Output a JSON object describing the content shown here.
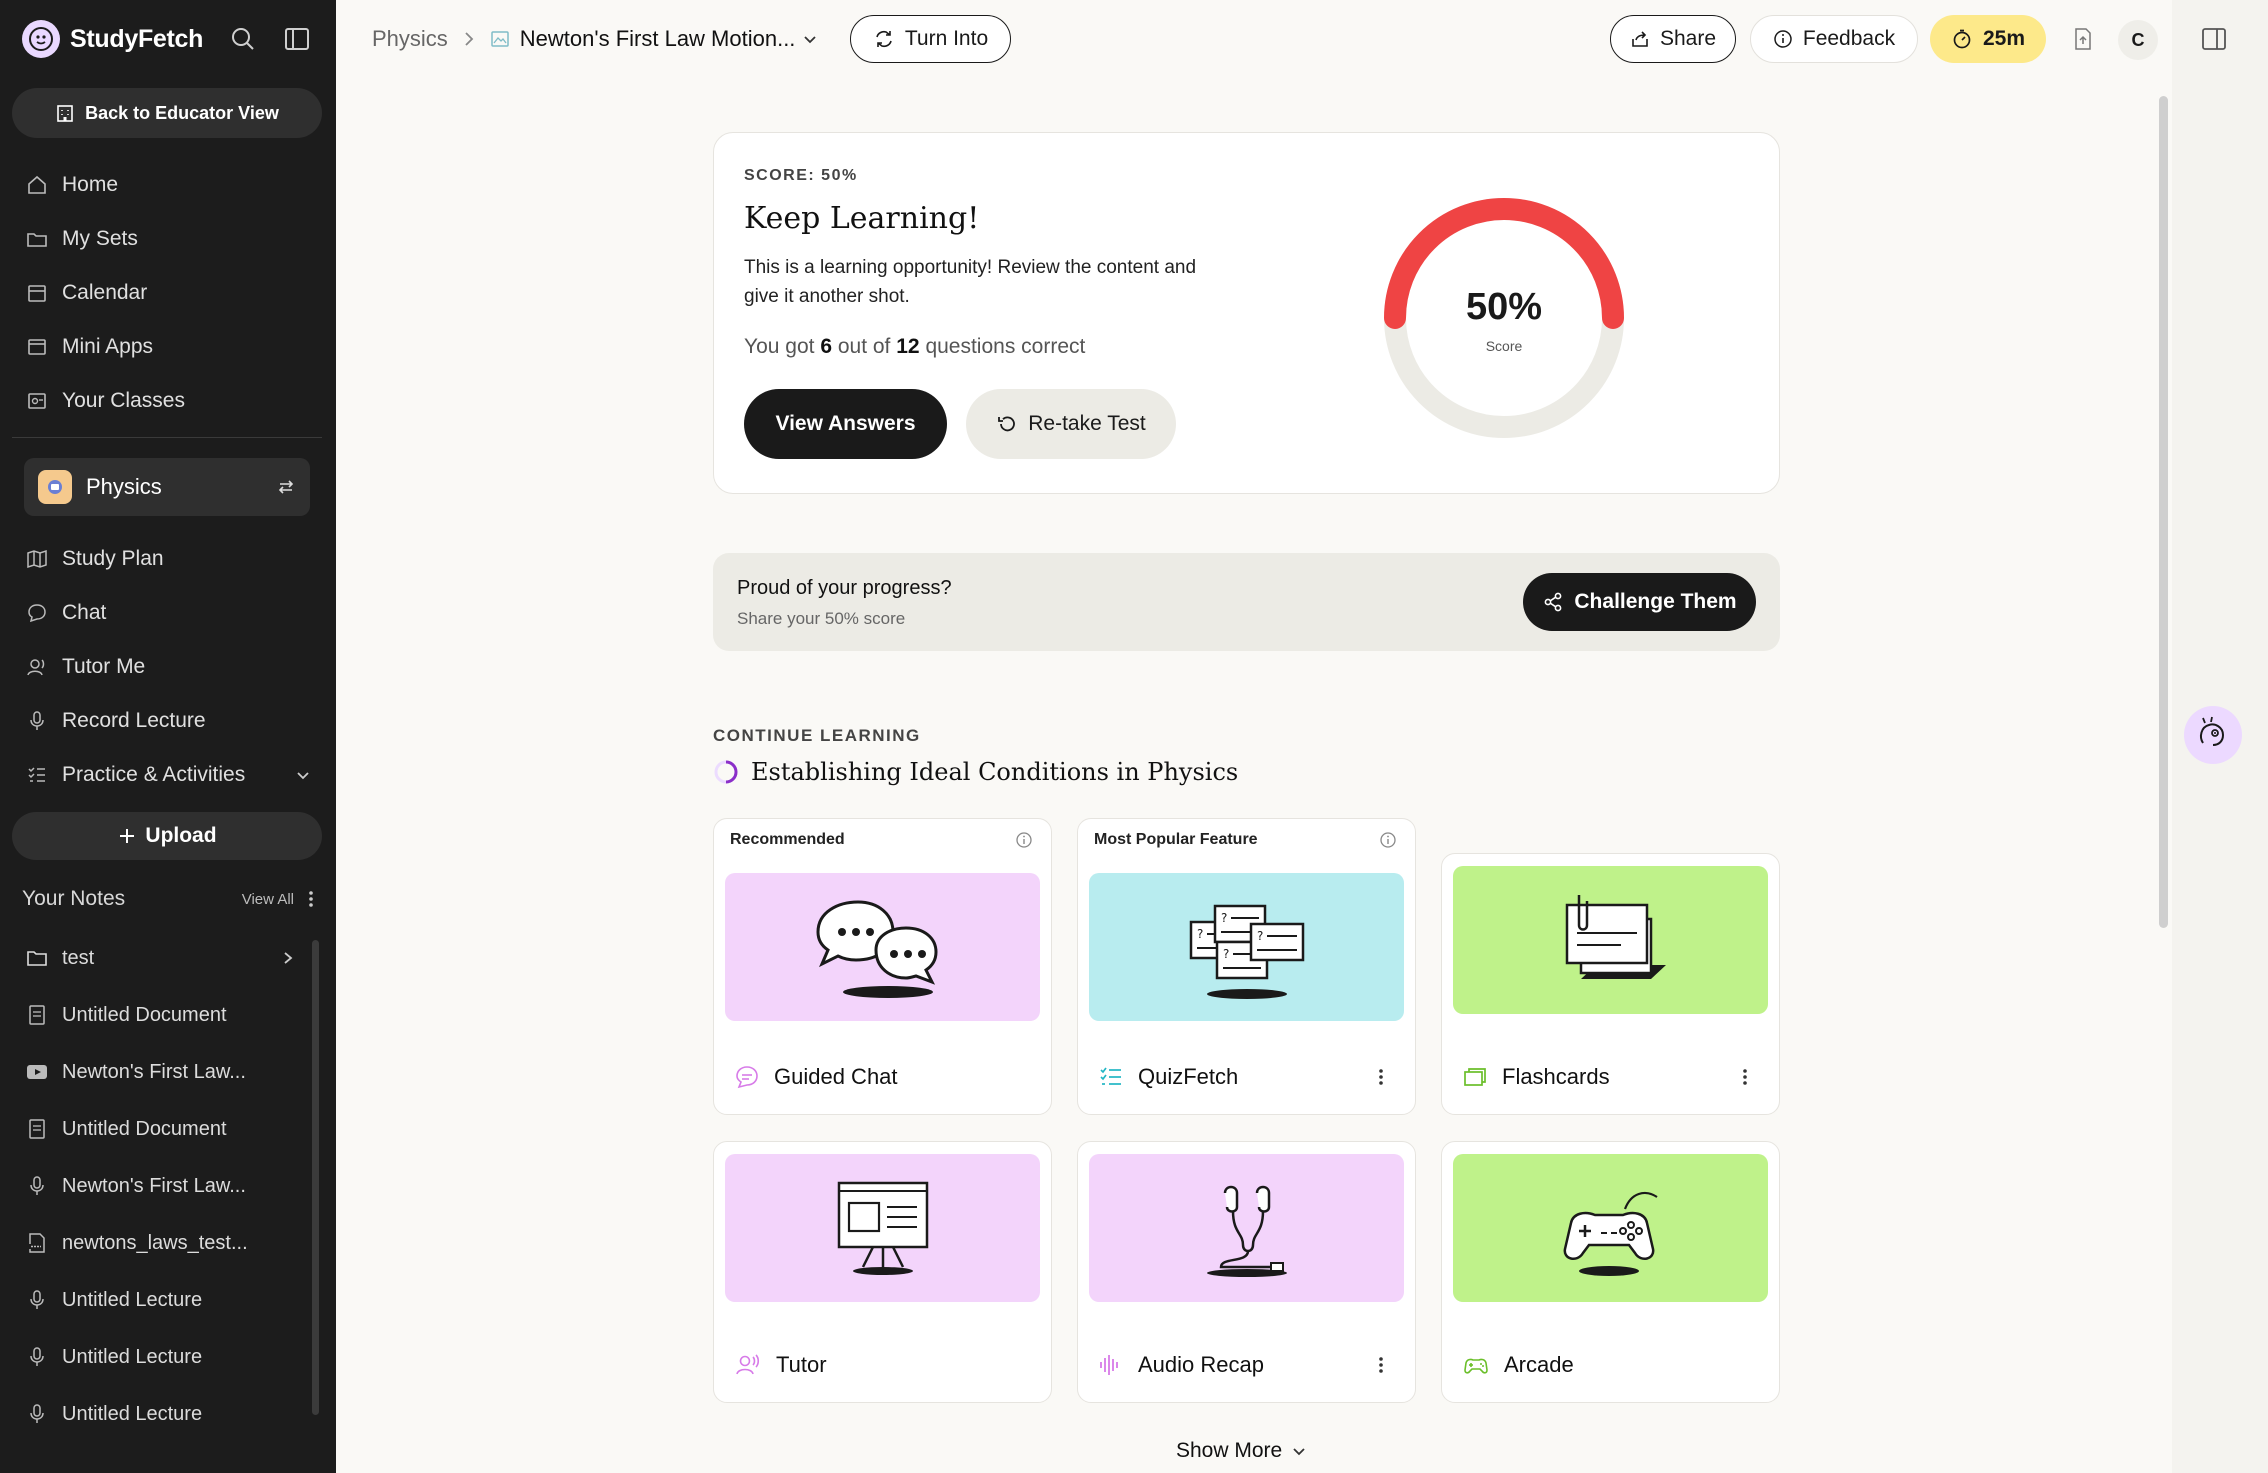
{
  "app": {
    "name": "StudyFetch"
  },
  "sidebar": {
    "educator_button": "Back to Educator View",
    "nav": [
      {
        "label": "Home",
        "icon": "home-icon"
      },
      {
        "label": "My Sets",
        "icon": "folder-icon"
      },
      {
        "label": "Calendar",
        "icon": "calendar-icon"
      },
      {
        "label": "Mini Apps",
        "icon": "window-icon"
      },
      {
        "label": "Your Classes",
        "icon": "classes-icon"
      }
    ],
    "subject": {
      "name": "Physics"
    },
    "subject_nav": [
      {
        "label": "Study Plan",
        "icon": "map-icon"
      },
      {
        "label": "Chat",
        "icon": "chat-icon"
      },
      {
        "label": "Tutor Me",
        "icon": "tutor-icon"
      },
      {
        "label": "Record Lecture",
        "icon": "mic-icon"
      },
      {
        "label": "Practice & Activities",
        "icon": "list-icon"
      }
    ],
    "upload_label": "Upload",
    "notes_title": "Your Notes",
    "notes_view_all": "View All",
    "notes": [
      {
        "label": "test",
        "icon": "folder-icon"
      },
      {
        "label": "Untitled Document",
        "icon": "document-icon"
      },
      {
        "label": "Newton's First Law...",
        "icon": "youtube-icon"
      },
      {
        "label": "Untitled Document",
        "icon": "document-icon"
      },
      {
        "label": "Newton's First Law...",
        "icon": "mic-icon"
      },
      {
        "label": "newtons_laws_test...",
        "icon": "pdf-icon"
      },
      {
        "label": "Untitled Lecture",
        "icon": "mic-icon"
      },
      {
        "label": "Untitled Lecture",
        "icon": "mic-icon"
      },
      {
        "label": "Untitled Lecture",
        "icon": "mic-icon"
      }
    ]
  },
  "header": {
    "breadcrumb_root": "Physics",
    "breadcrumb_current": "Newton's First Law Motion...",
    "turn_into": "Turn Into",
    "share": "Share",
    "feedback": "Feedback",
    "timer": "25m",
    "avatar_initial": "C"
  },
  "score": {
    "label": "SCORE: 50%",
    "heading": "Keep Learning!",
    "description": "This is a learning opportunity! Review the content and give it another shot.",
    "stat_prefix": "You got",
    "correct": "6",
    "stat_mid": "out of",
    "total": "12",
    "stat_suffix": "questions correct",
    "gauge_value": "50%",
    "gauge_label": "Score",
    "gauge_fraction": 0.5,
    "gauge_color": "#ef4444",
    "view_answers": "View Answers",
    "retake": "Re-take Test"
  },
  "progress_share": {
    "title": "Proud of your progress?",
    "subtitle": "Share your 50% score",
    "button": "Challenge Them"
  },
  "continue_learning": {
    "label": "CONTINUE LEARNING",
    "title": "Establishing Ideal Conditions in Physics"
  },
  "features": [
    {
      "tag": "Recommended",
      "label": "Guided Chat",
      "bg": "#f3d4fb",
      "icon": "guided-chat-icon"
    },
    {
      "tag": "Most Popular Feature",
      "label": "QuizFetch",
      "bg": "#b8ecef",
      "icon": "quiz-icon"
    },
    {
      "tag": "",
      "label": "Flashcards",
      "bg": "#bff28a",
      "icon": "flashcards-icon"
    },
    {
      "tag": "",
      "label": "Tutor",
      "bg": "#f3d4fb",
      "icon": "tutor-icon"
    },
    {
      "tag": "",
      "label": "Audio Recap",
      "bg": "#f3d4fb",
      "icon": "audio-icon"
    },
    {
      "tag": "",
      "label": "Arcade",
      "bg": "#bff28a",
      "icon": "arcade-icon"
    }
  ],
  "show_more": "Show More"
}
